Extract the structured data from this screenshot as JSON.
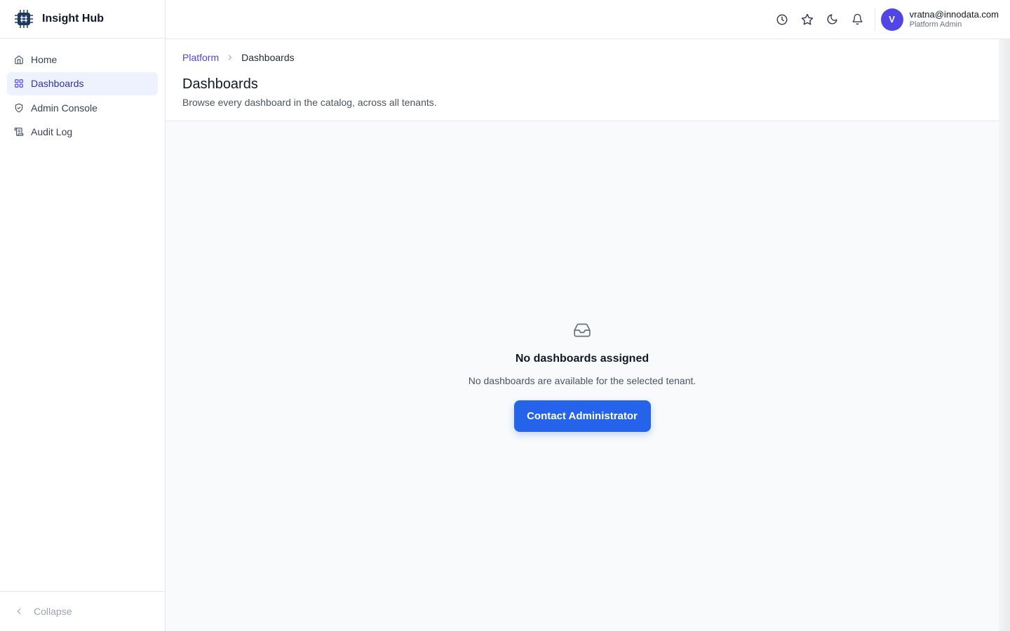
{
  "brand": {
    "name": "Insight Hub"
  },
  "sidebar": {
    "items": [
      {
        "label": "Home",
        "icon": "home-icon"
      },
      {
        "label": "Dashboards",
        "icon": "grid-icon",
        "active": true
      },
      {
        "label": "Admin Console",
        "icon": "shield-check-icon"
      },
      {
        "label": "Audit Log",
        "icon": "scroll-icon"
      }
    ],
    "collapse_label": "Collapse"
  },
  "header": {
    "icons": [
      "history-icon",
      "star-icon",
      "moon-icon",
      "bell-icon"
    ],
    "user": {
      "initial": "V",
      "email": "vratna@innodata.com",
      "role": "Platform Admin"
    }
  },
  "breadcrumb": {
    "root": "Platform",
    "current": "Dashboards"
  },
  "page": {
    "title": "Dashboards",
    "subtitle": "Browse every dashboard in the catalog, across all tenants."
  },
  "empty_state": {
    "icon": "inbox-icon",
    "title": "No dashboards assigned",
    "message": "No dashboards are available for the selected tenant.",
    "button_label": "Contact Administrator"
  },
  "colors": {
    "accent": "#4f46e5",
    "button": "#2563eb",
    "active_bg": "#eef2ff"
  }
}
